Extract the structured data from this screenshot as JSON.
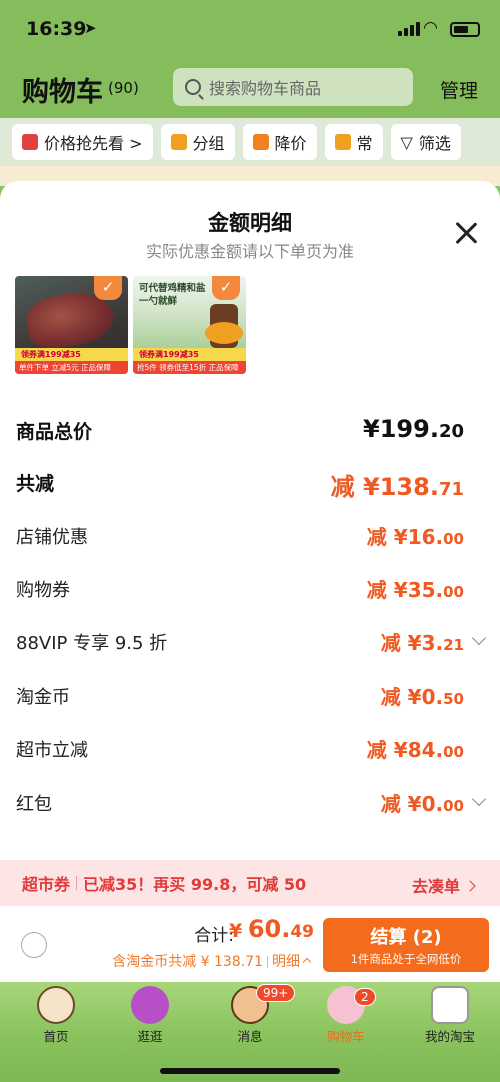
{
  "status": {
    "time": "16:39"
  },
  "cart": {
    "title": "购物车",
    "count": "(90)",
    "search_placeholder": "搜索购物车商品",
    "manage": "管理",
    "filters": [
      "价格抢先看 >",
      "分组",
      "降价",
      "常",
      "筛选"
    ]
  },
  "modal": {
    "title": "金额明细",
    "subtitle": "实际优惠金额请以下单页为准",
    "products": [
      {
        "badge_top": "领券满199减35",
        "badge_bottom": "单件下单 立减5元  正品保障"
      },
      {
        "headline_1": "可代替鸡精和盐",
        "headline_2": "一勺就鲜",
        "badge_top": "领券满199减35",
        "badge_bottom": "抢5件  领券低至15折  正品保障"
      }
    ],
    "rows": [
      {
        "label": "商品总价",
        "prefix": "¥",
        "int": "199.",
        "dec": "20"
      },
      {
        "label": "共减",
        "prefix": "减 ¥",
        "int": "138.",
        "dec": "71"
      },
      {
        "label": "店铺优惠",
        "prefix": "减 ¥",
        "int": "16.",
        "dec": "00"
      },
      {
        "label": "购物券",
        "prefix": "减 ¥",
        "int": "35.",
        "dec": "00"
      },
      {
        "label": "88VIP 专享 9.5 折",
        "prefix": "减 ¥",
        "int": "3.",
        "dec": "21"
      },
      {
        "label": "淘金币",
        "prefix": "减 ¥",
        "int": "0.",
        "dec": "50"
      },
      {
        "label": "超市立减",
        "prefix": "减 ¥",
        "int": "84.",
        "dec": "00"
      },
      {
        "label": "红包",
        "prefix": "减 ¥",
        "int": "0.",
        "dec": "00"
      }
    ]
  },
  "coupon_bar": {
    "part1": "超市券",
    "part2": "已减35！再买 99.8，可减 50",
    "action": "去凑单"
  },
  "checkout": {
    "total_label": "合计:",
    "currency": "¥",
    "total_int": "60.",
    "total_dec": "49",
    "sub_text": "含淘金币共减 ¥ 138.71",
    "detail_link": "明细",
    "pay_label": "结算 (2)",
    "pay_sub": "1件商品处于全网低价"
  },
  "tabs": [
    {
      "label": "首页",
      "badge": ""
    },
    {
      "label": "逛逛",
      "badge": ""
    },
    {
      "label": "消息",
      "badge": "99+"
    },
    {
      "label": "购物车",
      "badge": "2"
    },
    {
      "label": "我的淘宝",
      "badge": ""
    }
  ],
  "colors": {
    "accent": "#f05a22",
    "pay": "#f36b1c",
    "coupon_text": "#e03a3a",
    "tab_bg": "#8cc45f"
  }
}
